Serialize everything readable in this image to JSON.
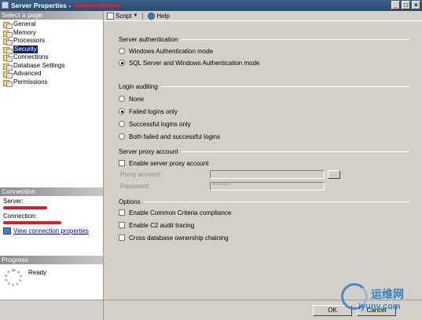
{
  "window": {
    "title": "Server Properties - ",
    "buttons": [
      "_",
      "□",
      "×"
    ]
  },
  "left": {
    "select_page_header": "Select a page",
    "pages": [
      {
        "label": "General",
        "selected": false
      },
      {
        "label": "Memory",
        "selected": false
      },
      {
        "label": "Processors",
        "selected": false
      },
      {
        "label": "Security",
        "selected": true
      },
      {
        "label": "Connections",
        "selected": false
      },
      {
        "label": "Database Settings",
        "selected": false
      },
      {
        "label": "Advanced",
        "selected": false
      },
      {
        "label": "Permissions",
        "selected": false
      }
    ],
    "connection": {
      "header": "Connection",
      "server_label": "Server:",
      "connection_label": "Connection:",
      "link": "View connection properties"
    },
    "progress": {
      "header": "Progress",
      "status": "Ready"
    }
  },
  "toolbar": {
    "script": "Script",
    "help": "Help"
  },
  "server_auth": {
    "title": "Server authentication",
    "windows": "Windows Authentication mode",
    "mixed": "SQL Server and Windows Authentication mode",
    "selected": "mixed"
  },
  "login_auditing": {
    "title": "Login auditing",
    "none": "None",
    "failed": "Failed logins only",
    "successful": "Successful logins only",
    "both": "Both failed and successful logins",
    "selected": "failed"
  },
  "proxy": {
    "title": "Server proxy account",
    "enable": "Enable server proxy account",
    "enabled": false,
    "account_label": "Proxy account:",
    "account_value": "",
    "password_label": "Password:",
    "password_value": "**********",
    "browse": "..."
  },
  "options": {
    "title": "Options",
    "common_criteria": "Enable Common Criteria compliance",
    "c2": "Enable C2 audit tracing",
    "cross_db": "Cross database ownership chaining"
  },
  "buttons": {
    "ok": "OK",
    "cancel": "Cancel"
  },
  "watermark": {
    "cn": "运维网",
    "url": "iyunv.com"
  },
  "colors": {
    "titlebar": "#2b4a72",
    "selection": "#0a246a",
    "redaction": "#d8202a",
    "link": "#0000cc"
  }
}
